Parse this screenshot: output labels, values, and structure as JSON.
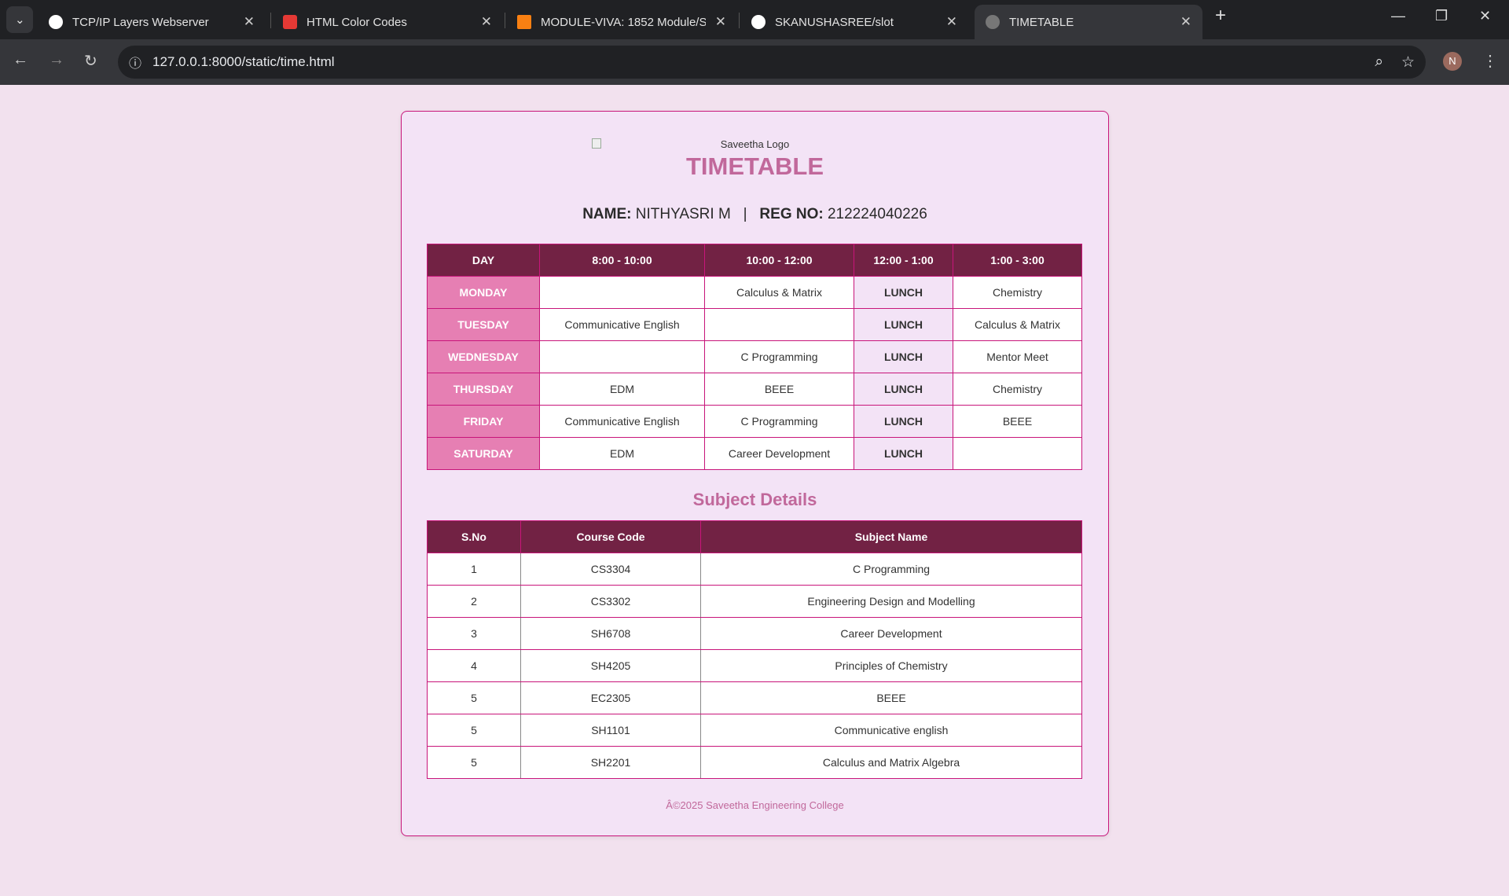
{
  "browser": {
    "tabs": [
      {
        "title": "TCP/IP Layers Webserver",
        "icon": "chatgpt-icon",
        "color": "#ffffff"
      },
      {
        "title": "HTML Color Codes",
        "icon": "html-color-codes-icon",
        "color": "#e53935"
      },
      {
        "title": "MODULE-VIVA: 1852 Module/S",
        "icon": "moodle-icon",
        "color": "#f98012"
      },
      {
        "title": "SKANUSHASREE/slot",
        "icon": "github-icon",
        "color": "#ffffff"
      },
      {
        "title": "TIMETABLE",
        "icon": "globe-icon",
        "color": "#888888",
        "active": true
      }
    ],
    "url": "127.0.0.1:8000/static/time.html",
    "profile_initial": "N"
  },
  "page": {
    "logo_alt": "Saveetha Logo",
    "title": "TIMETABLE",
    "name_label": "NAME:",
    "name": "NITHYASRI M",
    "separator": "|",
    "reg_label": "REG NO:",
    "reg": "212224040226",
    "timetable": {
      "headers": [
        "DAY",
        "8:00 - 10:00",
        "10:00 - 12:00",
        "12:00 - 1:00",
        "1:00 - 3:00"
      ],
      "rows": [
        [
          "MONDAY",
          "",
          "Calculus & Matrix",
          "LUNCH",
          "Chemistry"
        ],
        [
          "TUESDAY",
          "Communicative English",
          "",
          "LUNCH",
          "Calculus & Matrix"
        ],
        [
          "WEDNESDAY",
          "",
          "C Programming",
          "LUNCH",
          "Mentor Meet"
        ],
        [
          "THURSDAY",
          "EDM",
          "BEEE",
          "LUNCH",
          "Chemistry"
        ],
        [
          "FRIDAY",
          "Communicative English",
          "C Programming",
          "LUNCH",
          "BEEE"
        ],
        [
          "SATURDAY",
          "EDM",
          "Career Development",
          "LUNCH",
          ""
        ]
      ]
    },
    "subject_heading": "Subject Details",
    "subjects": {
      "headers": [
        "S.No",
        "Course Code",
        "Subject Name"
      ],
      "rows": [
        [
          "1",
          "CS3304",
          "C Programming"
        ],
        [
          "2",
          "CS3302",
          "Engineering Design and Modelling"
        ],
        [
          "3",
          "SH6708",
          "Career Development"
        ],
        [
          "4",
          "SH4205",
          "Principles of Chemistry"
        ],
        [
          "5",
          "EC2305",
          "BEEE"
        ],
        [
          "5",
          "SH1101",
          "Communicative english"
        ],
        [
          "5",
          "SH2201",
          "Calculus and Matrix Algebra"
        ]
      ]
    },
    "footer": "Â©2025 Saveetha Engineering College"
  },
  "colors": {
    "header": "#722244",
    "day": "#e67fb3",
    "accent": "#c1689b",
    "border": "#c8157a"
  }
}
